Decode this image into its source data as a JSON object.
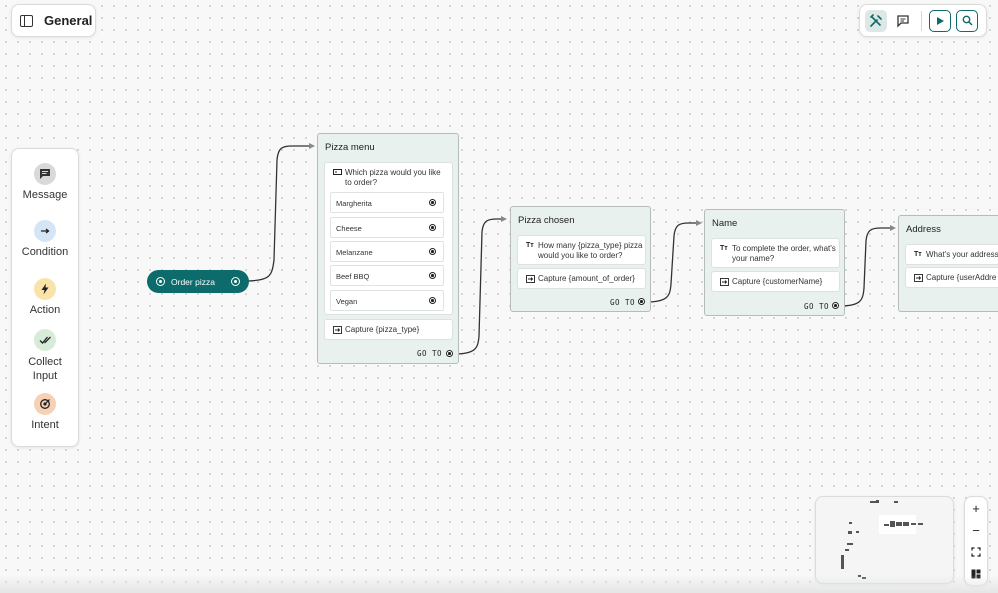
{
  "header": {
    "title": "General"
  },
  "toolbar": {
    "buttons": [
      {
        "icon": "tools-icon",
        "active": true
      },
      {
        "icon": "comment-icon",
        "active": false
      },
      {
        "icon": "play-icon",
        "active": false
      },
      {
        "icon": "search-icon",
        "active": false
      }
    ]
  },
  "palette": {
    "items": [
      {
        "label": "Message",
        "icon": "message-icon",
        "color": "#d9d9d9"
      },
      {
        "label": "Condition",
        "icon": "arrow-right-icon",
        "color": "#d4e6f5"
      },
      {
        "label": "Action",
        "icon": "lightning-icon",
        "color": "#f9e3a8"
      },
      {
        "label": "Collect Input",
        "icon": "double-check-icon",
        "color": "#d6ecd8"
      },
      {
        "label": "Intent",
        "icon": "target-icon",
        "color": "#f7d1b5"
      }
    ]
  },
  "flow": {
    "start": {
      "label": "Order pizza"
    },
    "nodes": {
      "pizza_menu": {
        "title": "Pizza menu",
        "question": "Which pizza would you like to order?",
        "options": [
          "Margherita",
          "Cheese",
          "Melanzane",
          "Beef BBQ",
          "Vegan"
        ],
        "capture": "Capture {pizza_type}",
        "goto": "GO TO"
      },
      "pizza_chosen": {
        "title": "Pizza chosen",
        "question": "How many {pizza_type} pizza would you like to order?",
        "capture": "Capture {amount_of_order}",
        "goto": "GO TO"
      },
      "name": {
        "title": "Name",
        "question": "To complete the order, what's your name?",
        "capture": "Capture {customerName}",
        "goto": "GO TO"
      },
      "address": {
        "title": "Address",
        "question": "What's your address?",
        "capture": "Capture {userAddre"
      }
    }
  },
  "zoom_controls": [
    {
      "label": "+",
      "icon": "zoom-in-icon"
    },
    {
      "label": "−",
      "icon": "zoom-out-icon"
    },
    {
      "label": "",
      "icon": "fit-view-icon"
    },
    {
      "label": "",
      "icon": "layout-icon"
    }
  ],
  "theme": {
    "accent": "#0d6b6b",
    "node_bg": "#e8f1ee"
  }
}
